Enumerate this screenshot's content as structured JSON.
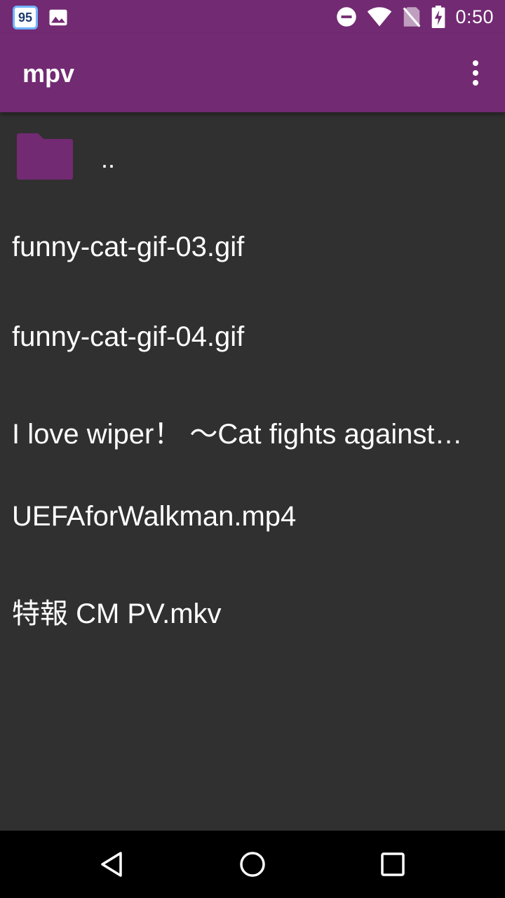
{
  "status_bar": {
    "notification_badge": "95",
    "time": "0:50",
    "icons": [
      "app-badge-icon",
      "image-icon",
      "do-not-disturb-icon",
      "wifi-icon",
      "no-sim-icon",
      "battery-charging-icon"
    ]
  },
  "app_bar": {
    "title": "mpv",
    "menu_icon": "more-vert-icon"
  },
  "file_list": {
    "parent": {
      "label": "..",
      "icon": "folder-icon"
    },
    "items": [
      {
        "label": "funny-cat-gif-03.gif"
      },
      {
        "label": "funny-cat-gif-04.gif"
      },
      {
        "label": "I love wiper！ 〜Cat fights against…"
      },
      {
        "label": "UEFAforWalkman.mp4"
      },
      {
        "label": "特報 CM PV.mkv"
      }
    ]
  },
  "nav_bar": {
    "icons": [
      "back-icon",
      "home-icon",
      "recents-icon"
    ]
  },
  "colors": {
    "primary": "#722a72",
    "background": "#303030",
    "text": "#ffffff",
    "nav_background": "#000000"
  }
}
